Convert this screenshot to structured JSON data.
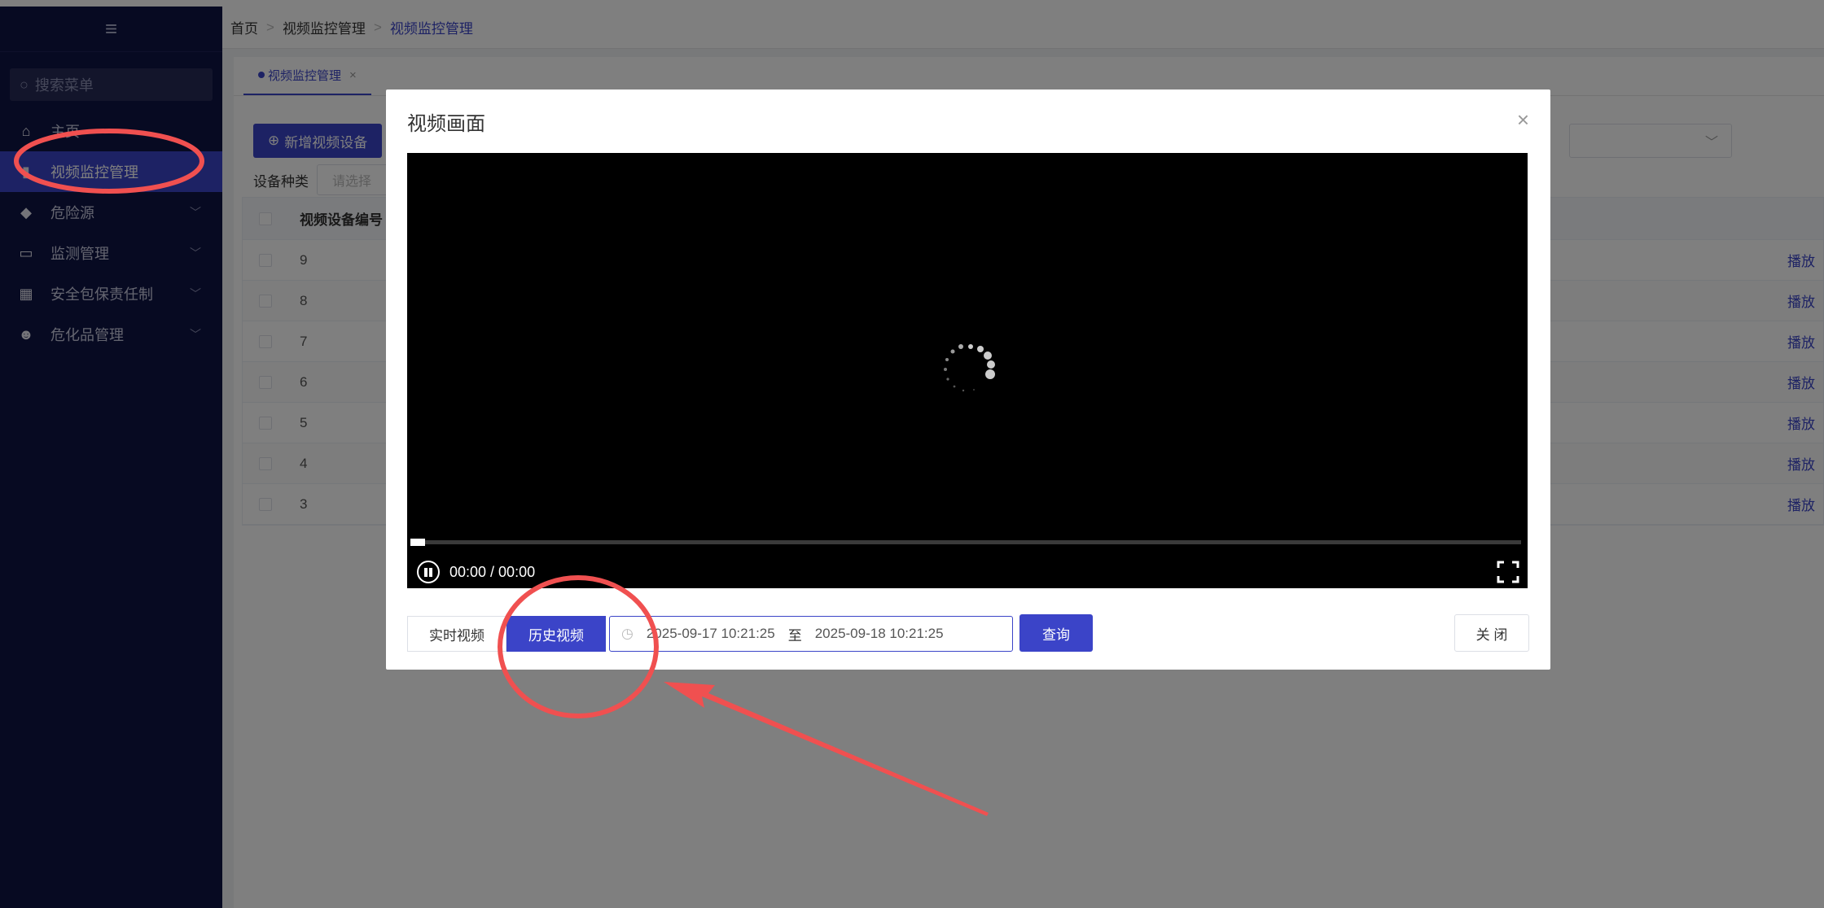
{
  "sidebar": {
    "search_placeholder": "搜索菜单",
    "items": [
      {
        "label": "主页",
        "icon": "home-icon"
      },
      {
        "label": "视频监控管理",
        "icon": "video-icon"
      },
      {
        "label": "危险源",
        "icon": "diamond-icon"
      },
      {
        "label": "监测管理",
        "icon": "monitor-icon"
      },
      {
        "label": "安全包保责任制",
        "icon": "grid-icon"
      },
      {
        "label": "危化品管理",
        "icon": "skull-icon"
      }
    ]
  },
  "breadcrumb": [
    "首页",
    "视频监控管理",
    "视频监控管理"
  ],
  "tab": {
    "label": "视频监控管理"
  },
  "toolbar": {
    "add_label": "新增视频设备"
  },
  "filter": {
    "label": "设备种类",
    "placeholder": "请选择"
  },
  "table": {
    "header": "视频设备编号",
    "rows": [
      "9",
      "8",
      "7",
      "6",
      "5",
      "4",
      "3"
    ],
    "action_label": "播放"
  },
  "dialog": {
    "title": "视频画面",
    "time_display": "00:00 / 00:00",
    "progress": 0,
    "realtime_label": "实时视频",
    "history_label": "历史视频",
    "range_start": "2025-09-17 10:21:25",
    "range_sep": "至",
    "range_end": "2025-09-18 10:21:25",
    "query_label": "查询",
    "close_label": "关 闭"
  },
  "colors": {
    "accent": "#3b44c8",
    "sidebar": "#0f1445",
    "annotation": "#f05050"
  }
}
